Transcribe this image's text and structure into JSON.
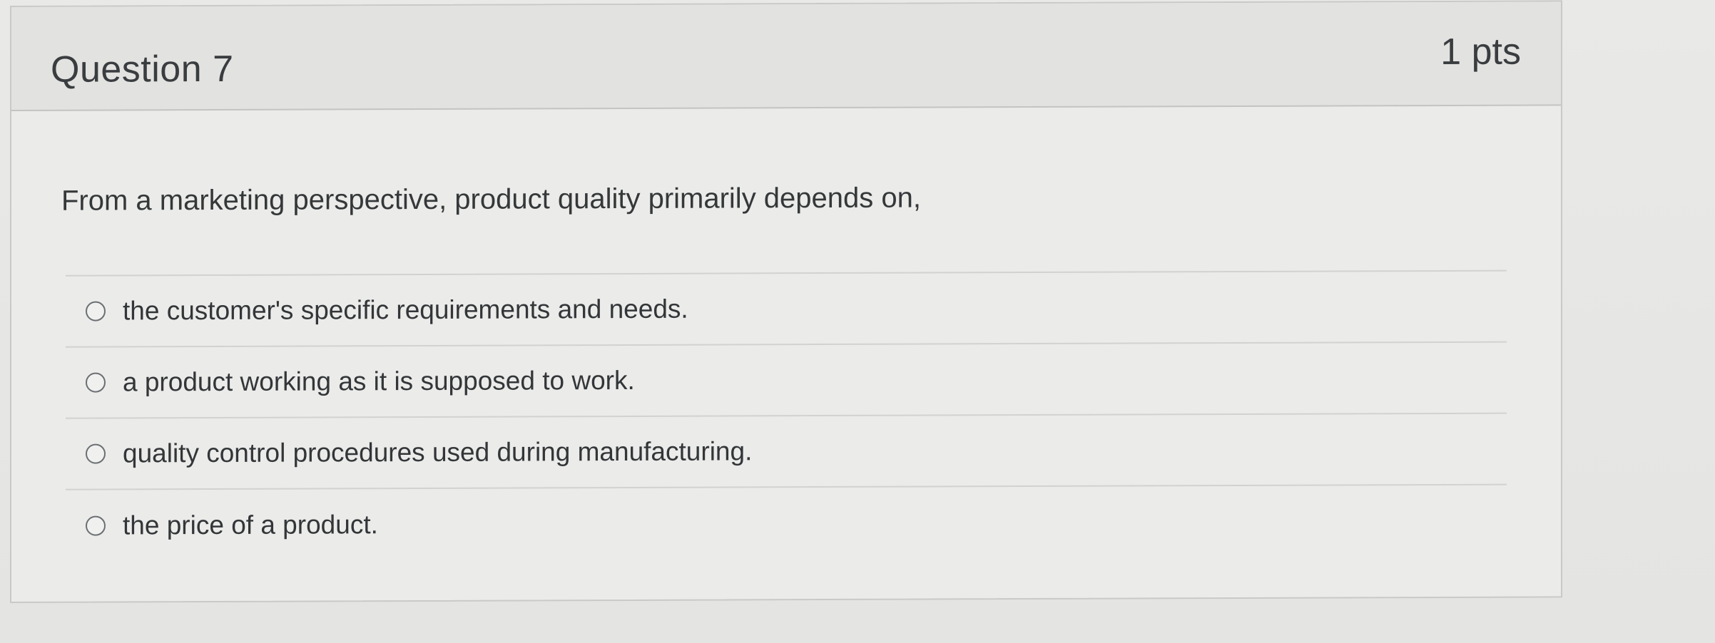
{
  "question": {
    "title": "Question 7",
    "points": "1 pts",
    "prompt": "From a marketing perspective, product quality primarily depends on,",
    "answers": [
      {
        "label": "the customer's specific requirements and needs."
      },
      {
        "label": "a product working as it is supposed to work."
      },
      {
        "label": "quality control procedures used during manufacturing."
      },
      {
        "label": "the price of a product."
      }
    ]
  }
}
